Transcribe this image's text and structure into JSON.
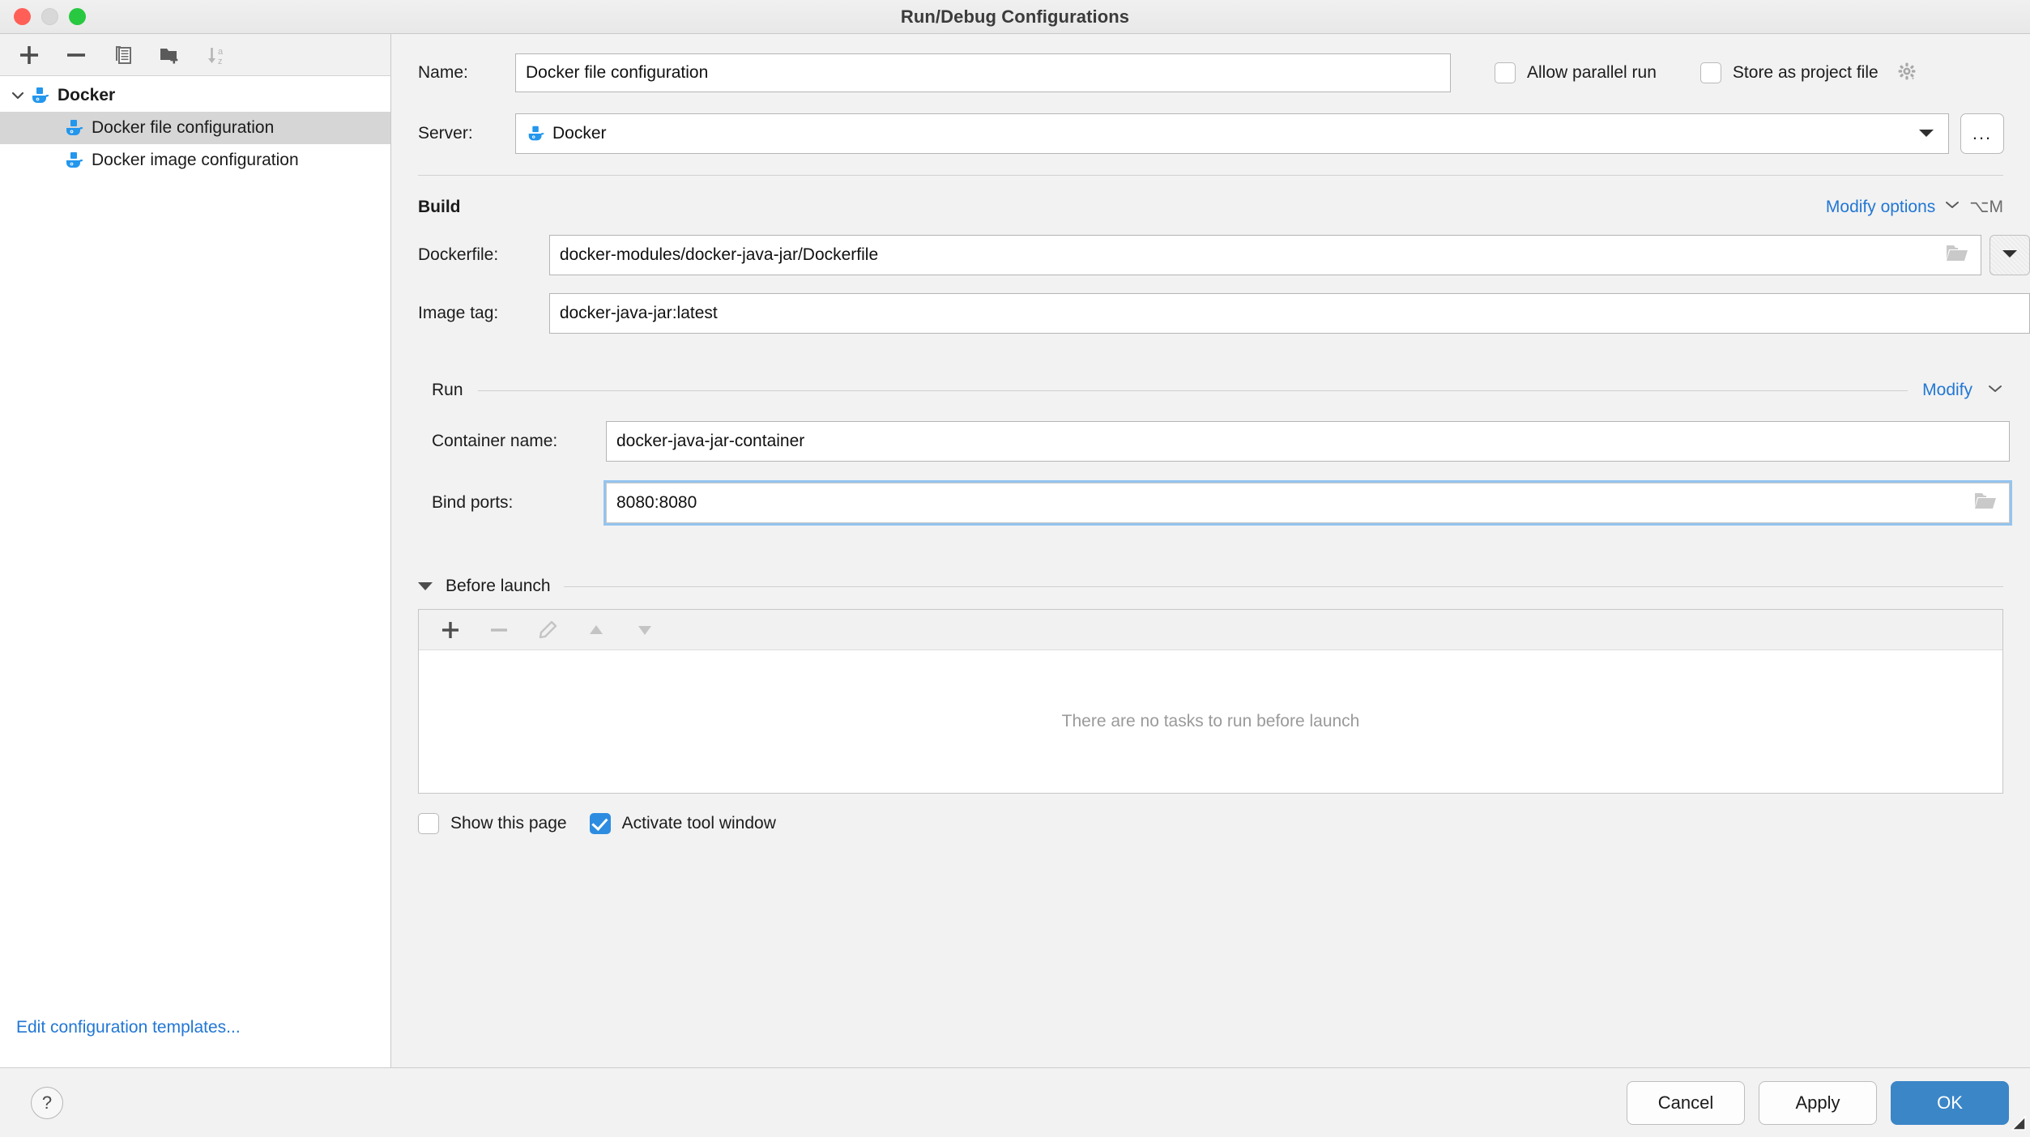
{
  "window": {
    "title": "Run/Debug Configurations",
    "traffic_lights": [
      "close",
      "minimize",
      "zoom"
    ]
  },
  "sidebar": {
    "toolbar": [
      {
        "name": "add-configuration",
        "icon": "plus-icon"
      },
      {
        "name": "remove-configuration",
        "icon": "minus-icon"
      },
      {
        "name": "copy-configuration",
        "icon": "copy-icon"
      },
      {
        "name": "new-folder",
        "icon": "folder-add-icon"
      },
      {
        "name": "sort-configurations",
        "icon": "sort-az-icon"
      }
    ],
    "tree": {
      "root": {
        "label": "Docker",
        "expanded": true
      },
      "children": [
        {
          "label": "Docker file configuration",
          "selected": true
        },
        {
          "label": "Docker image configuration",
          "selected": false
        }
      ]
    },
    "edit_templates_link": "Edit configuration templates..."
  },
  "form": {
    "name_label": "Name:",
    "name_value": "Docker file configuration",
    "allow_parallel_run": {
      "label": "Allow parallel run",
      "checked": false
    },
    "store_as_project_file": {
      "label": "Store as project file",
      "checked": false
    },
    "server_label": "Server:",
    "server_value": "Docker",
    "server_more_button": "...",
    "build": {
      "title": "Build",
      "modify_options_label": "Modify options",
      "modify_options_shortcut": "⌥M",
      "dockerfile_label": "Dockerfile:",
      "dockerfile_value": "docker-modules/docker-java-jar/Dockerfile",
      "image_tag_label": "Image tag:",
      "image_tag_value": "docker-java-jar:latest"
    },
    "run": {
      "title": "Run",
      "modify_label": "Modify",
      "container_name_label": "Container name:",
      "container_name_value": "docker-java-jar-container",
      "bind_ports_label": "Bind ports:",
      "bind_ports_value": "8080:8080"
    },
    "before_launch": {
      "title": "Before launch",
      "expanded": true,
      "toolbar": [
        {
          "name": "add-task",
          "icon": "plus-icon",
          "enabled": true
        },
        {
          "name": "remove-task",
          "icon": "minus-icon",
          "enabled": false
        },
        {
          "name": "edit-task",
          "icon": "pencil-icon",
          "enabled": false
        },
        {
          "name": "move-task-up",
          "icon": "triangle-up-icon",
          "enabled": false
        },
        {
          "name": "move-task-down",
          "icon": "triangle-down-icon",
          "enabled": false
        }
      ],
      "empty_text": "There are no tasks to run before launch",
      "show_this_page": {
        "label": "Show this page",
        "checked": false
      },
      "activate_tool_window": {
        "label": "Activate tool window",
        "checked": true
      }
    }
  },
  "footer": {
    "help_label": "?",
    "cancel_label": "Cancel",
    "apply_label": "Apply",
    "ok_label": "OK"
  },
  "colors": {
    "accent_blue": "#2277d4",
    "primary_button": "#3b86c7",
    "checkbox_checked": "#2d8ce0",
    "docker_blue": "#2396ed",
    "selection_gray": "#d6d6d6",
    "window_bg": "#f2f2f2"
  }
}
